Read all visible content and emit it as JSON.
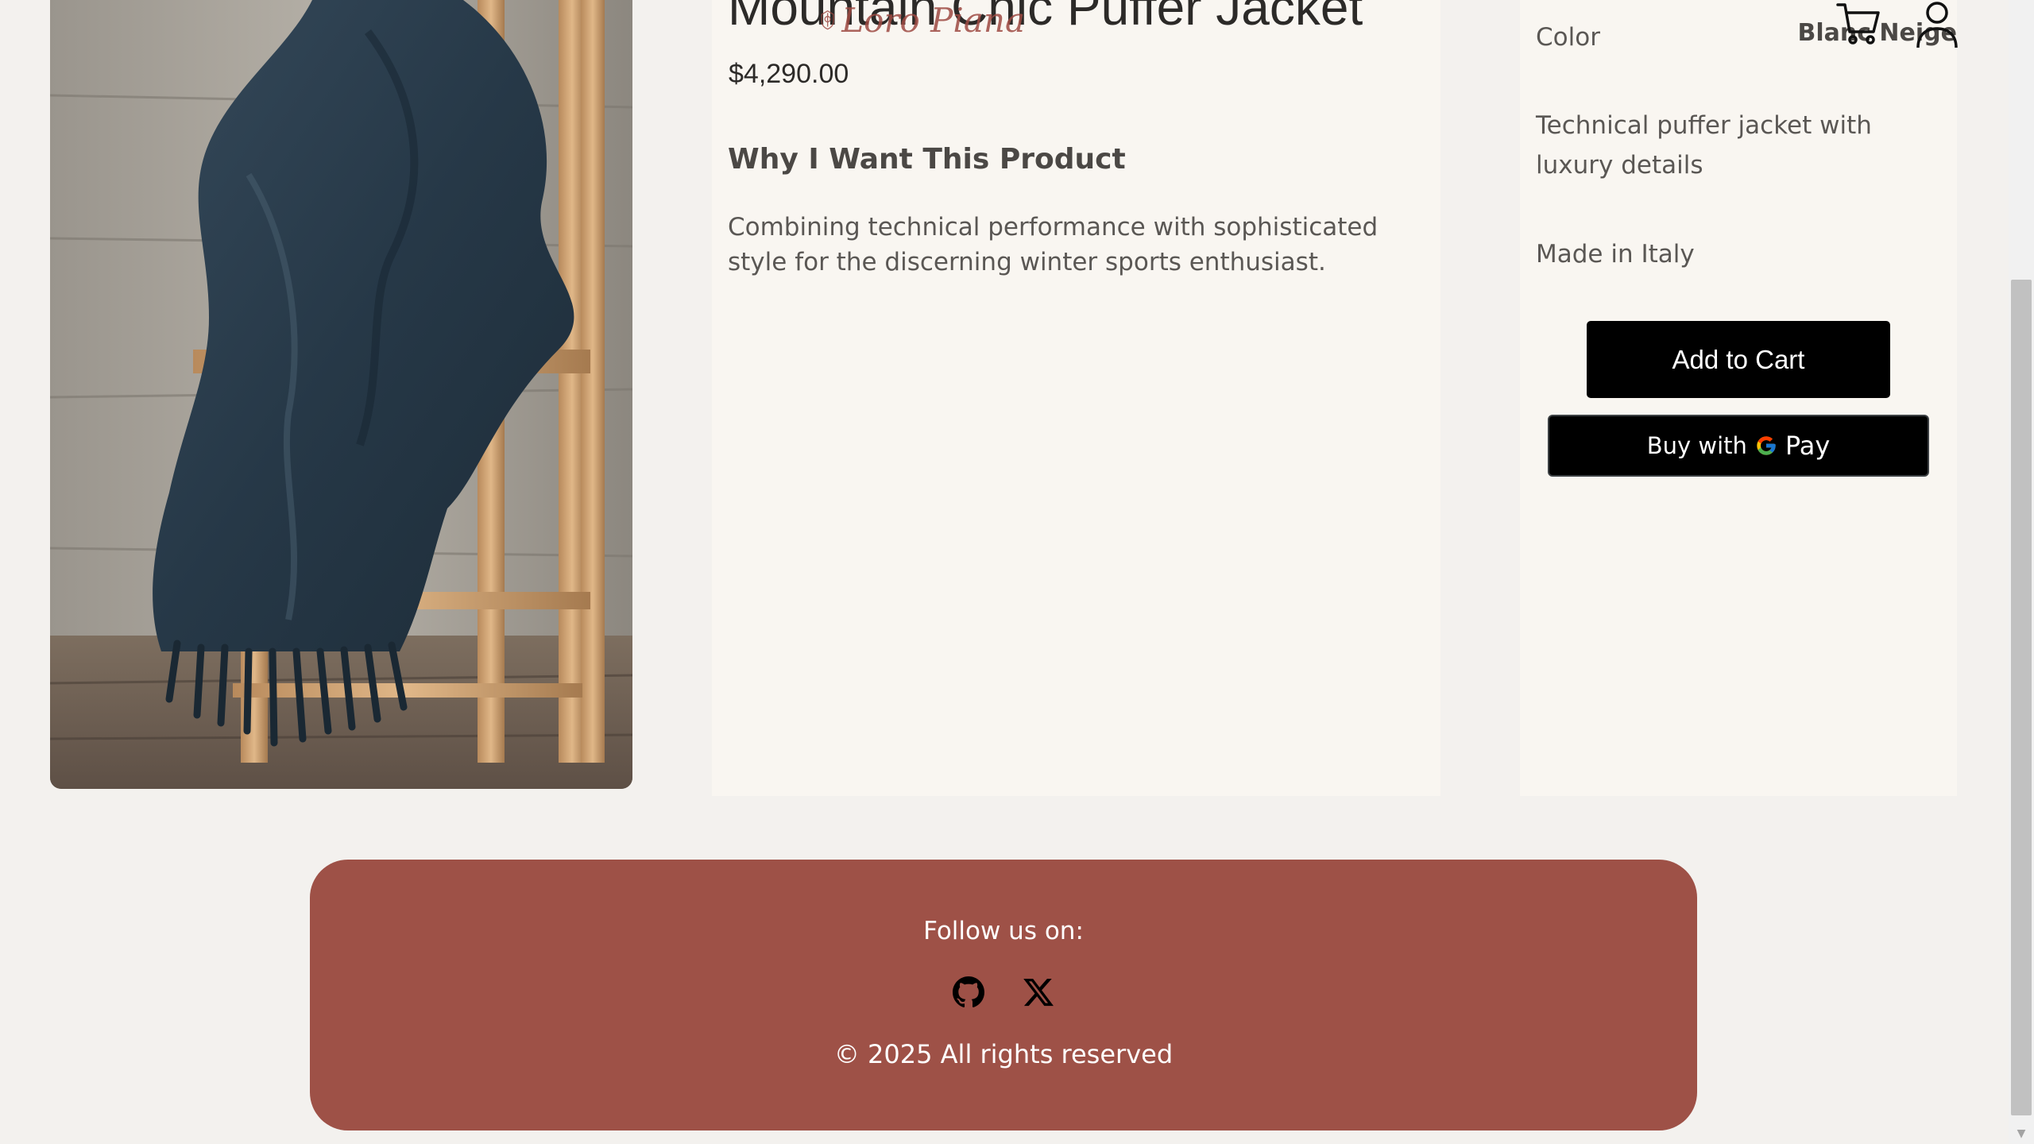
{
  "product": {
    "title": "Mountain Chic Puffer Jacket",
    "price": "$4,290.00",
    "image_alt": "Dark blue wool throw draped over a rustic wooden chair"
  },
  "why_section": {
    "heading": "Why I Want This Product",
    "text": "Combining technical performance with sophisticated style for the discerning winter sports enthusiast."
  },
  "purchase": {
    "color_label": "Color",
    "color_value": "Blanc Neige",
    "description": "Technical puffer jacket with luxury details",
    "origin": "Made in Italy",
    "add_to_cart_label": "Add to Cart",
    "gpay_prefix": "Buy with",
    "gpay_suffix": "Pay"
  },
  "header": {
    "logo_text": "Loro Piana",
    "icons": [
      "cart-icon",
      "user-icon"
    ]
  },
  "footer": {
    "follow_text": "Follow us on:",
    "social": [
      "github-icon",
      "x-icon"
    ],
    "copyright": "© 2025 All rights reserved"
  },
  "colors": {
    "page_bg": "#f3f1ee",
    "card_bg": "#f9f6f1",
    "footer_bg": "#9e5147",
    "logo": "#9e4a43",
    "button_bg": "#000000"
  }
}
